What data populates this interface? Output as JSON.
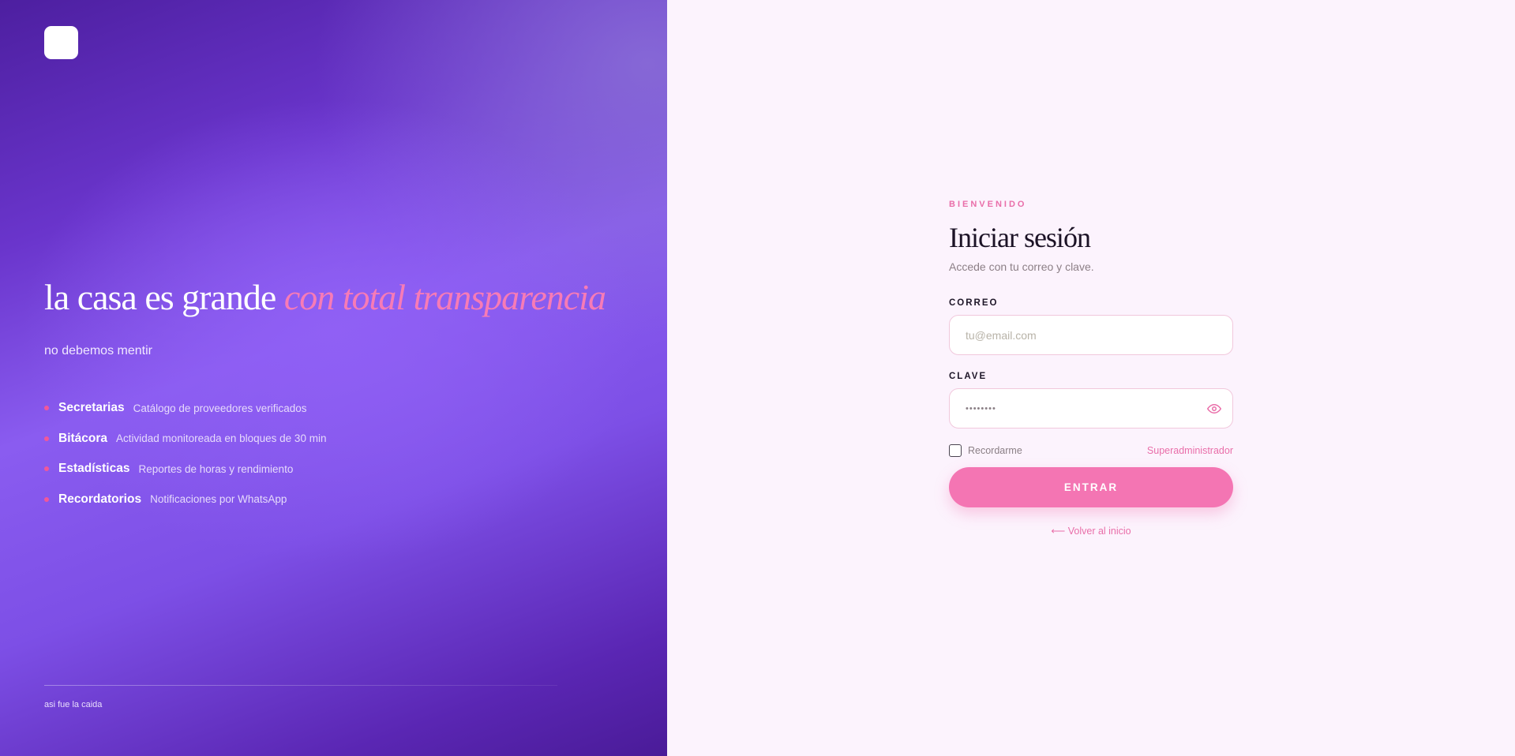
{
  "hero": {
    "title_main": "la casa es grande ",
    "title_accent": "con total transparencia",
    "subtitle": "no debemos mentir",
    "features": [
      {
        "name": "Secretarias",
        "description": "Catálogo de proveedores verificados"
      },
      {
        "name": "Bitácora",
        "description": "Actividad monitoreada en bloques de 30 min"
      },
      {
        "name": "Estadísticas",
        "description": "Reportes de horas y rendimiento"
      },
      {
        "name": "Recordatorios",
        "description": "Notificaciones por WhatsApp"
      }
    ],
    "footer": "asi fue la caida"
  },
  "login": {
    "eyebrow": "BIENVENIDO",
    "title": "Iniciar sesión",
    "subtitle": "Accede con tu correo y clave.",
    "email_label": "CORREO",
    "email_placeholder": "tu@email.com",
    "email_value": "",
    "password_label": "CLAVE",
    "password_value": "••••••••",
    "remember_label": "Recordarme",
    "remember_checked": false,
    "superadmin_link": "Superadministrador",
    "submit_label": "ENTRAR",
    "back_link": "⟵ Volver al inicio"
  },
  "icons": {
    "logo": "app-logo",
    "password_toggle": "eye-icon"
  },
  "colors": {
    "accent_pink": "#f475b3",
    "hero_purple": "#8a5cf0",
    "page_background": "#fcf3fd"
  }
}
